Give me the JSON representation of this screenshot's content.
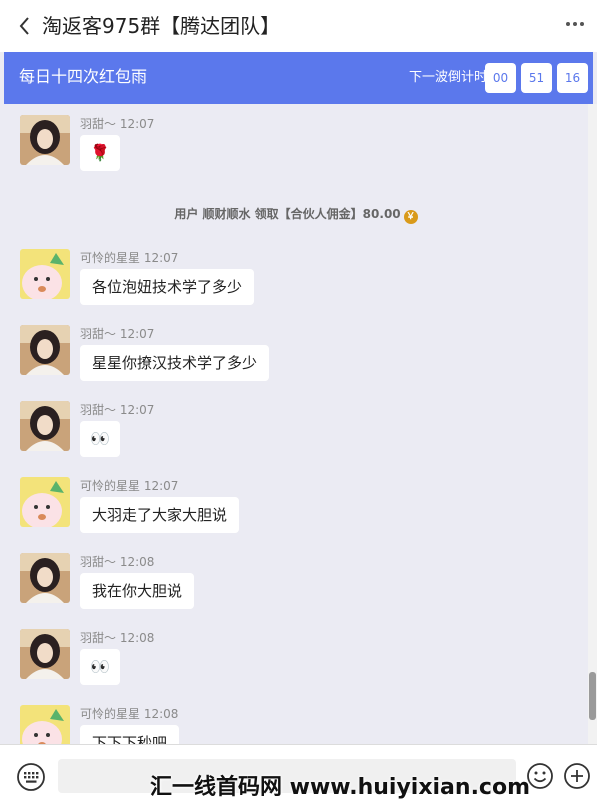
{
  "header": {
    "back_icon": "chevron-left-icon",
    "title": "淘返客975群【腾达团队】",
    "more_icon": "more-horizontal-icon"
  },
  "banner": {
    "title": "每日十四次红包雨",
    "countdown_label": "下一波倒计时",
    "hours": "00",
    "minutes": "51",
    "seconds": "16",
    "color": "#5b78ec"
  },
  "chat": {
    "system_notice": "用户 顺财顺水 领取【合伙人佣金】80.00",
    "messages": [
      {
        "sender": "羽甜～",
        "time": "12:07",
        "text": "🌹",
        "avatar": "girl-photo-avatar"
      },
      {
        "sender": "可怜的星星",
        "time": "12:07",
        "text": "各位泡妞技术学了多少",
        "avatar": "cartoon-avatar"
      },
      {
        "sender": "羽甜～",
        "time": "12:07",
        "text": "星星你撩汉技术学了多少",
        "avatar": "girl-photo-avatar"
      },
      {
        "sender": "羽甜～",
        "time": "12:07",
        "text": "👀",
        "avatar": "girl-photo-avatar"
      },
      {
        "sender": "可怜的星星",
        "time": "12:07",
        "text": "大羽走了大家大胆说",
        "avatar": "cartoon-avatar"
      },
      {
        "sender": "羽甜～",
        "time": "12:08",
        "text": "我在你大胆说",
        "avatar": "girl-photo-avatar"
      },
      {
        "sender": "羽甜～",
        "time": "12:08",
        "text": "👀",
        "avatar": "girl-photo-avatar"
      },
      {
        "sender": "可怜的星星",
        "time": "12:08",
        "text": "下下下秒吧",
        "avatar": "cartoon-avatar"
      }
    ]
  },
  "input": {
    "keyboard_icon": "keyboard-icon",
    "value": "",
    "emoji_icon": "emoji-icon",
    "plus_icon": "plus-icon"
  },
  "watermark": "汇一线首码网 www.huiyixian.com"
}
